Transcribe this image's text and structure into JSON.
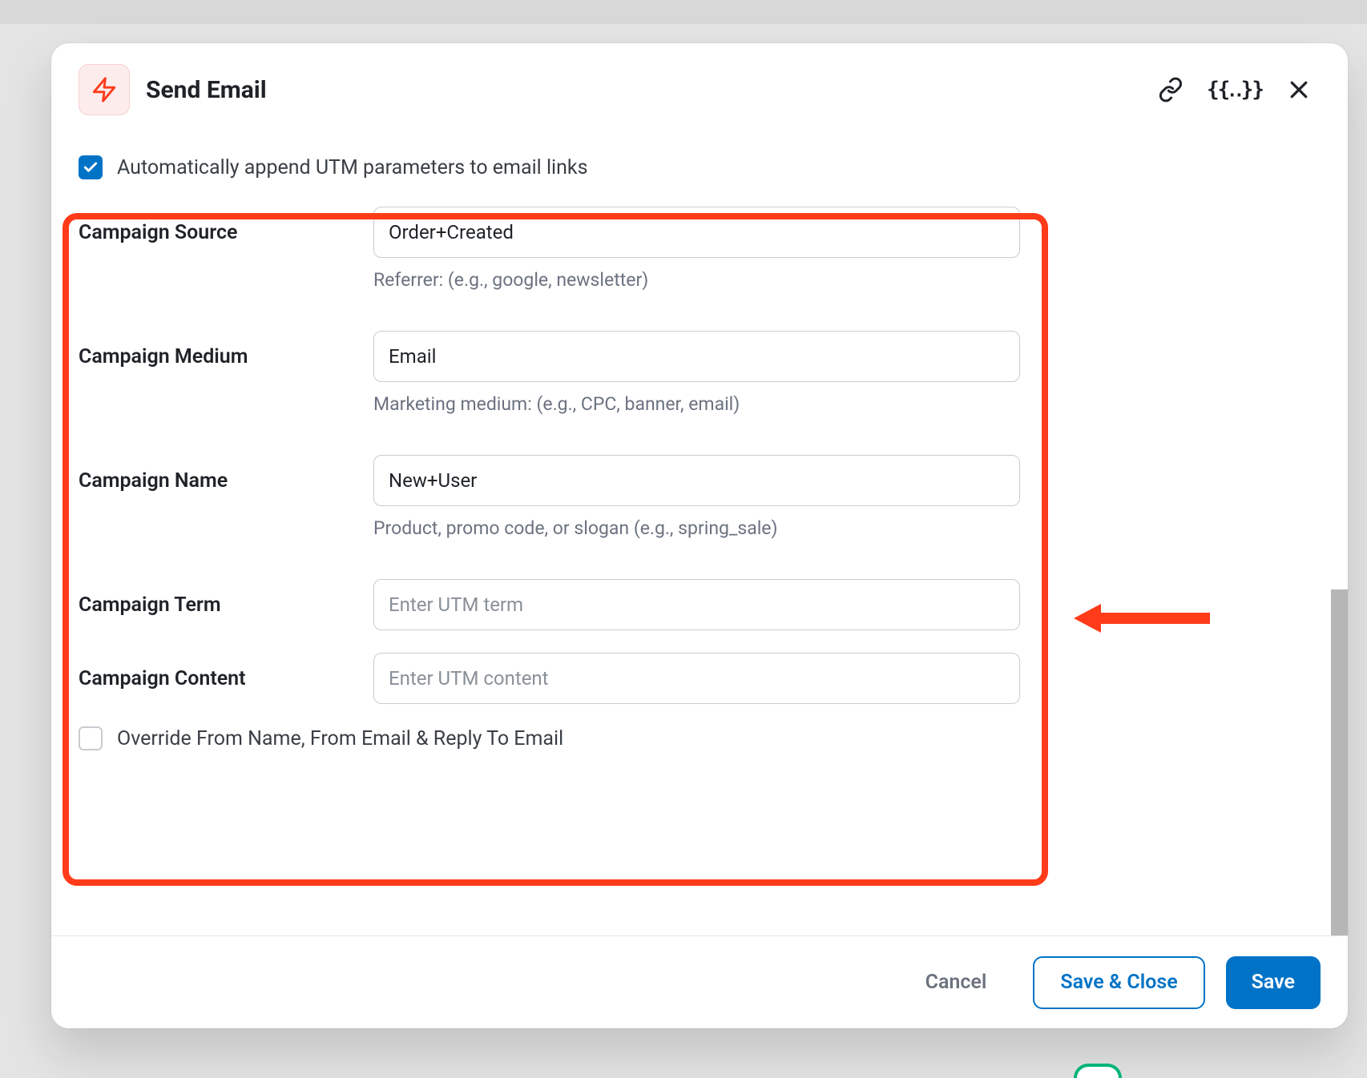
{
  "modal": {
    "title": "Send Email",
    "utm_checkbox_label": "Automatically append UTM parameters to email links",
    "override_checkbox_label": "Override From Name, From Email & Reply To Email"
  },
  "fields": {
    "source": {
      "label": "Campaign Source",
      "value": "Order+Created",
      "hint": "Referrer: (e.g., google, newsletter)"
    },
    "medium": {
      "label": "Campaign Medium",
      "value": "Email",
      "hint": "Marketing medium: (e.g., CPC, banner, email)"
    },
    "name": {
      "label": "Campaign Name",
      "value": "New+User",
      "hint": "Product, promo code, or slogan (e.g., spring_sale)"
    },
    "term": {
      "label": "Campaign Term",
      "placeholder": "Enter UTM term"
    },
    "content": {
      "label": "Campaign Content",
      "placeholder": "Enter UTM content"
    }
  },
  "footer": {
    "cancel": "Cancel",
    "save_close": "Save & Close",
    "save": "Save"
  },
  "colors": {
    "accent": "#0073c7",
    "highlight": "#ff3b1a"
  }
}
